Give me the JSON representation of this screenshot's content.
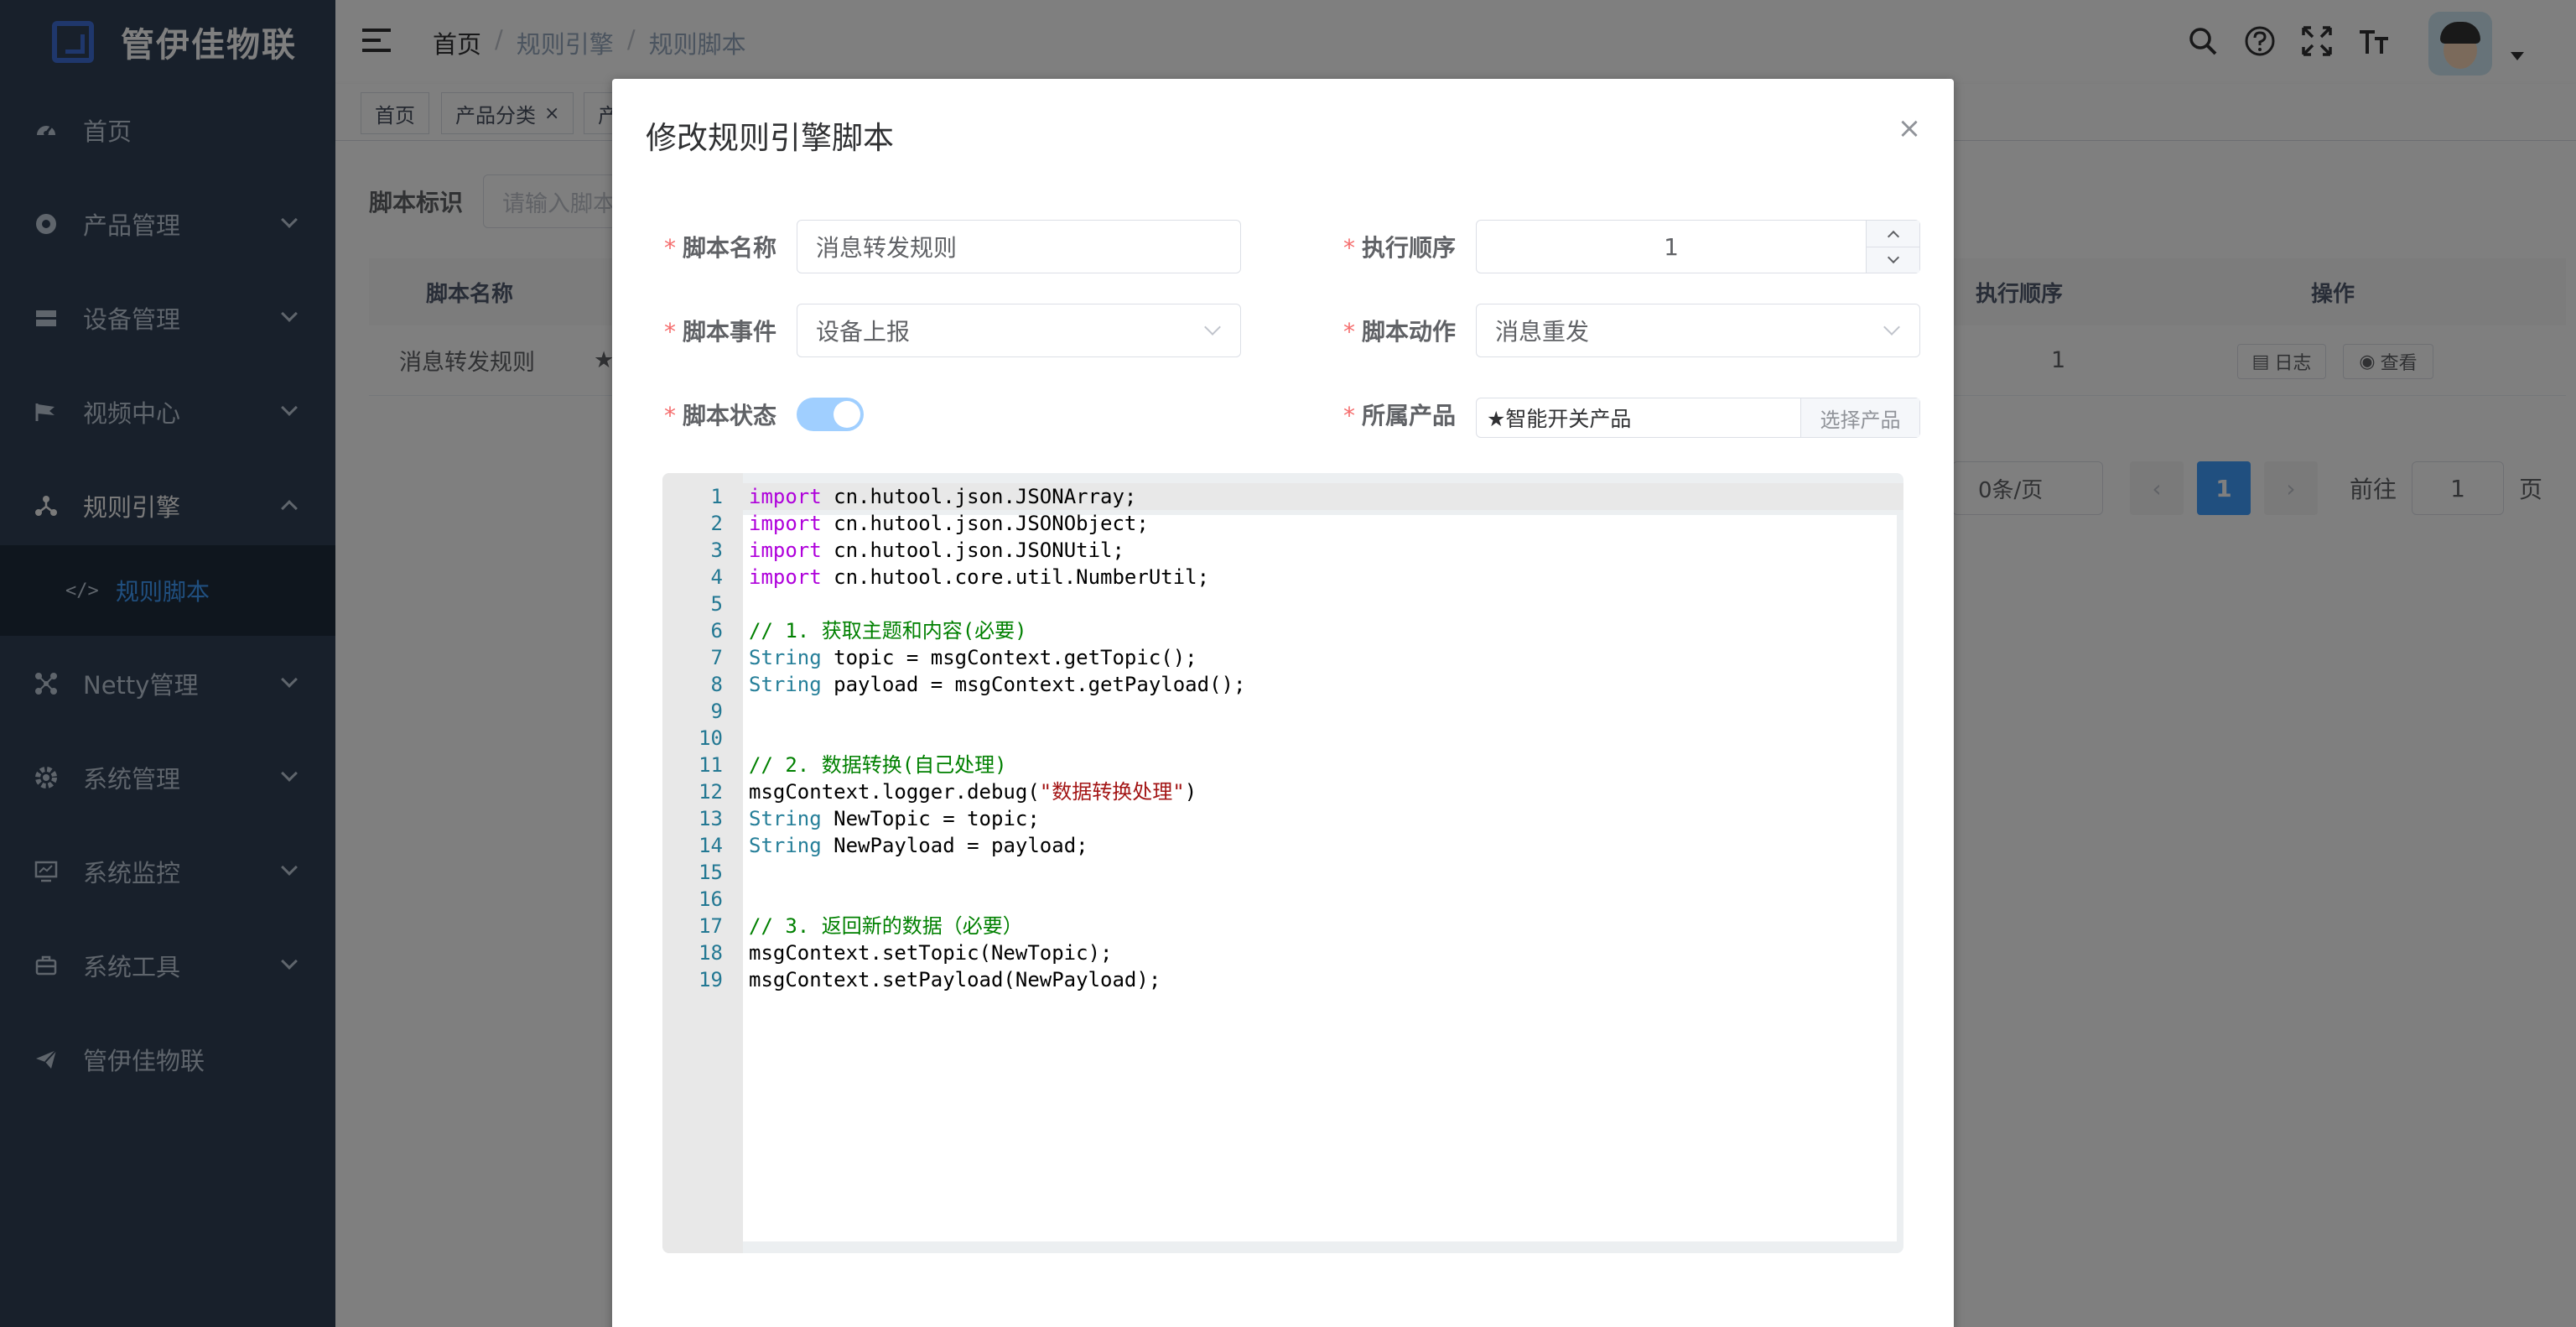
{
  "app": {
    "title": "管伊佳物联"
  },
  "sidebar": {
    "items": [
      {
        "label": "首页",
        "icon": "dashboard-icon"
      },
      {
        "label": "产品管理",
        "icon": "product-icon"
      },
      {
        "label": "设备管理",
        "icon": "device-icon"
      },
      {
        "label": "视频中心",
        "icon": "video-icon"
      },
      {
        "label": "规则引擎",
        "icon": "rule-engine-icon"
      },
      {
        "label": "Netty管理",
        "icon": "netty-icon"
      },
      {
        "label": "系统管理",
        "icon": "system-icon"
      },
      {
        "label": "系统监控",
        "icon": "monitor-icon"
      },
      {
        "label": "系统工具",
        "icon": "tool-icon"
      },
      {
        "label": "管伊佳物联",
        "icon": "send-icon"
      }
    ],
    "subitem": {
      "label": "规则脚本",
      "icon_text": "</>"
    }
  },
  "header": {
    "breadcrumb": [
      "首页",
      "规则引擎",
      "规则脚本"
    ],
    "sep": "/"
  },
  "tags": [
    {
      "label": "首页"
    },
    {
      "label": "产品分类"
    },
    {
      "label": "产"
    }
  ],
  "filter": {
    "label": "脚本标识",
    "placeholder": "请输入脚本"
  },
  "table": {
    "headers": [
      "脚本名称",
      "执行顺序",
      "操作"
    ],
    "rows": [
      {
        "name": "消息转发规则",
        "star": "★",
        "order": "1",
        "log": "日志",
        "view": "查看"
      }
    ]
  },
  "pager": {
    "size_text": "0条/页",
    "current": "1",
    "goto_label": "前往",
    "goto_value": "1",
    "page_unit": "页"
  },
  "dialog": {
    "title": "修改规则引擎脚本",
    "close": "×",
    "fields": {
      "name": {
        "label": "脚本名称",
        "value": "消息转发规则"
      },
      "order": {
        "label": "执行顺序",
        "value": "1"
      },
      "event": {
        "label": "脚本事件",
        "value": "设备上报"
      },
      "action": {
        "label": "脚本动作",
        "value": "消息重发"
      },
      "status": {
        "label": "脚本状态",
        "on": true
      },
      "product": {
        "label": "所属产品",
        "value": "★智能开关产品",
        "button": "选择产品"
      }
    },
    "required_mark": "*"
  },
  "code": {
    "lines": [
      "import cn.hutool.json.JSONArray;",
      "import cn.hutool.json.JSONObject;",
      "import cn.hutool.json.JSONUtil;",
      "import cn.hutool.core.util.NumberUtil;",
      "",
      "// 1. 获取主题和内容(必要)",
      "String topic = msgContext.getTopic();",
      "String payload = msgContext.getPayload();",
      "",
      "",
      "// 2. 数据转换(自己处理)",
      "msgContext.logger.debug(\"数据转换处理\")",
      "String NewTopic = topic;",
      "String NewPayload = payload;",
      "",
      "",
      "// 3. 返回新的数据（必要）",
      "msgContext.setTopic(NewTopic);",
      "msgContext.setPayload(NewPayload);"
    ],
    "line_numbers": [
      "1",
      "2",
      "3",
      "4",
      "5",
      "6",
      "7",
      "8",
      "9",
      "10",
      "11",
      "12",
      "13",
      "14",
      "15",
      "16",
      "17",
      "18",
      "19"
    ]
  },
  "colors": {
    "sidebar_bg": "#304156",
    "accent": "#409eff",
    "required": "#f56c6c",
    "switch_on": "#a0cfff"
  }
}
